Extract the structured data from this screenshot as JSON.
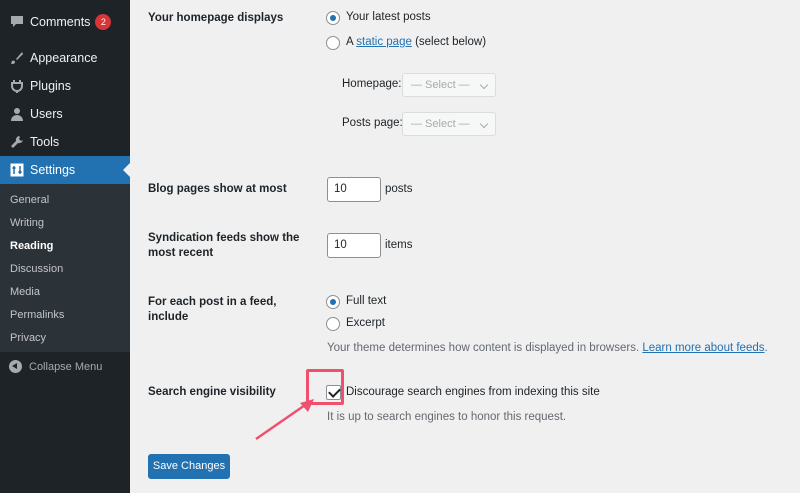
{
  "sidebar": {
    "comments": {
      "label": "Comments",
      "badge": "2"
    },
    "appearance": "Appearance",
    "plugins": "Plugins",
    "users": "Users",
    "tools": "Tools",
    "settings": "Settings",
    "submenu": [
      "General",
      "Writing",
      "Reading",
      "Discussion",
      "Media",
      "Permalinks",
      "Privacy"
    ],
    "collapse": "Collapse Menu"
  },
  "homepage": {
    "label": "Your homepage displays",
    "option_latest": "Your latest posts",
    "option_static_prefix": "A",
    "option_static_link": "static page",
    "option_static_suffix": "(select below)",
    "homepage_label": "Homepage:",
    "homepage_select": "— Select —",
    "posts_page_label": "Posts page:",
    "posts_page_select": "— Select —"
  },
  "blog_pages": {
    "label": "Blog pages show at most",
    "value": "10",
    "unit": "posts"
  },
  "syndication": {
    "label": "Syndication feeds show the most recent",
    "value": "10",
    "unit": "items"
  },
  "feed": {
    "label": "For each post in a feed, include",
    "option_full": "Full text",
    "option_excerpt": "Excerpt",
    "desc_prefix": "Your theme determines how content is displayed in browsers.",
    "desc_link": "Learn more about feeds",
    "desc_suffix": "."
  },
  "search": {
    "label": "Search engine visibility",
    "checkbox_label": "Discourage search engines from indexing this site",
    "desc": "It is up to search engines to honor this request."
  },
  "save_label": "Save Changes",
  "colors": {
    "accent": "#2271b1",
    "sidebar": "#1d2327",
    "highlight": "#f0506e"
  }
}
